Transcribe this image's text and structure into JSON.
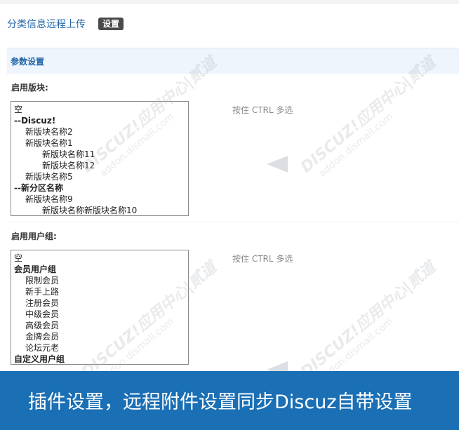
{
  "header": {
    "title": "分类信息远程上传",
    "settings_button": "设置"
  },
  "section": {
    "title": "参数设置"
  },
  "fields": {
    "forums": {
      "label": "启用版块:",
      "hint": "按住 CTRL 多选",
      "options": [
        {
          "text": "空",
          "level": 0,
          "bold": false
        },
        {
          "text": "--Discuz!",
          "level": 0,
          "bold": true
        },
        {
          "text": "新版块名称2",
          "level": 1,
          "bold": false
        },
        {
          "text": "新版块名称1",
          "level": 1,
          "bold": false
        },
        {
          "text": "新版块名称11",
          "level": 2,
          "bold": false
        },
        {
          "text": "新版块名称12",
          "level": 2,
          "bold": false
        },
        {
          "text": "新版块名称5",
          "level": 1,
          "bold": false
        },
        {
          "text": "--新分区名称",
          "level": 0,
          "bold": true
        },
        {
          "text": "新版块名称9",
          "level": 1,
          "bold": false
        },
        {
          "text": "新版块名称新版块名称10",
          "level": 2,
          "bold": false
        }
      ]
    },
    "usergroups": {
      "label": "启用用户组:",
      "hint": "按住 CTRL 多选",
      "options": [
        {
          "text": "空",
          "level": 0,
          "bold": false
        },
        {
          "text": "会员用户组",
          "level": 0,
          "bold": true
        },
        {
          "text": "限制会员",
          "level": 1,
          "bold": false
        },
        {
          "text": "新手上路",
          "level": 1,
          "bold": false
        },
        {
          "text": "注册会员",
          "level": 1,
          "bold": false
        },
        {
          "text": "中级会员",
          "level": 1,
          "bold": false
        },
        {
          "text": "高级会员",
          "level": 1,
          "bold": false
        },
        {
          "text": "金牌会员",
          "level": 1,
          "bold": false
        },
        {
          "text": "论坛元老",
          "level": 1,
          "bold": false
        },
        {
          "text": "自定义用户组",
          "level": 0,
          "bold": true
        }
      ]
    }
  },
  "watermark": {
    "brand": "DISCUZ!应用中心|贰道",
    "domain": "addon.dismall.com"
  },
  "banner": {
    "text": "插件设置，远程附件设置同步Discuz自带设置"
  },
  "colors": {
    "accent": "#2366a8",
    "banner_bg": "#1a6fb5",
    "section_bg": "#eef5fc"
  }
}
